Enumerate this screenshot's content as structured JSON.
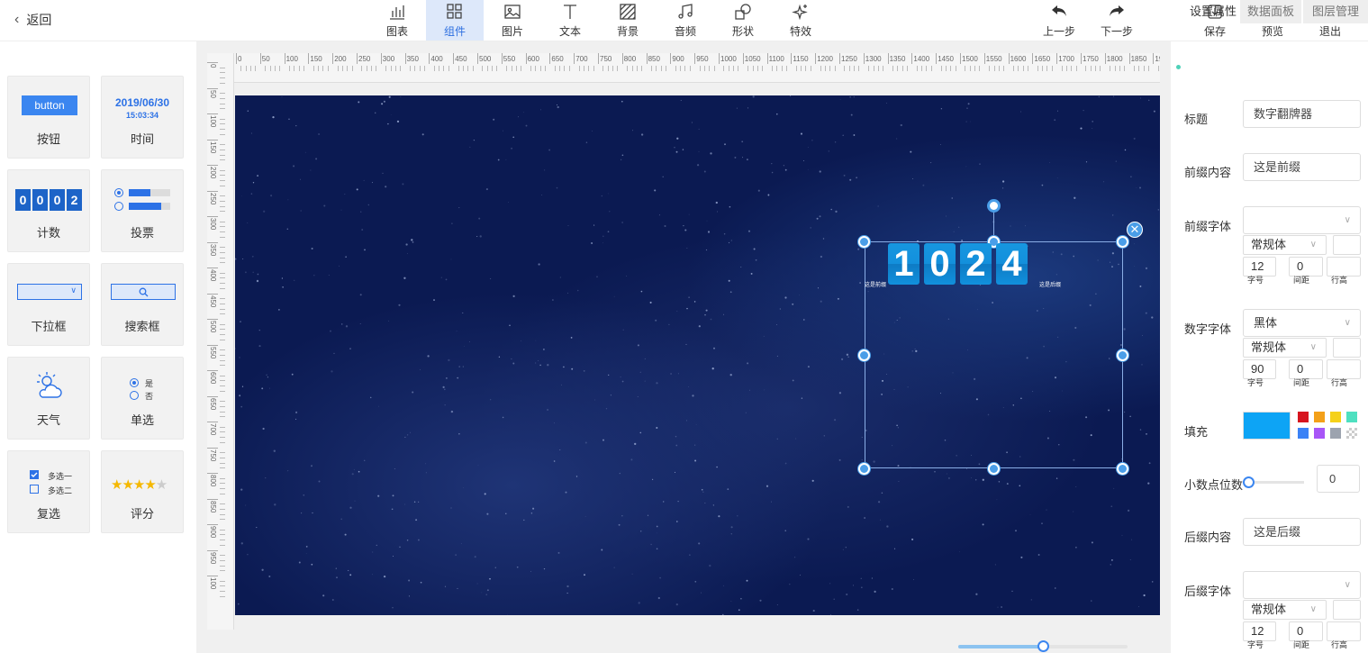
{
  "topbar": {
    "back_label": "返回",
    "tools": [
      {
        "label": "图表",
        "icon": "chart-icon"
      },
      {
        "label": "组件",
        "icon": "grid-icon",
        "active": true
      },
      {
        "label": "图片",
        "icon": "image-icon"
      },
      {
        "label": "文本",
        "icon": "text-icon"
      },
      {
        "label": "背景",
        "icon": "background-icon"
      },
      {
        "label": "音频",
        "icon": "music-icon"
      },
      {
        "label": "形状",
        "icon": "shape-icon"
      },
      {
        "label": "特效",
        "icon": "sparkle-icon"
      }
    ],
    "undo_label": "上一步",
    "redo_label": "下一步",
    "save_label": "保存",
    "preview_label": "预览",
    "exit_label": "退出"
  },
  "components": [
    {
      "label": "按钮",
      "preview_text": "button"
    },
    {
      "label": "时间",
      "preview_date": "2019/06/30",
      "preview_time": "15:03:34"
    },
    {
      "label": "计数",
      "preview_digits": [
        "0",
        "0",
        "0",
        "2"
      ]
    },
    {
      "label": "投票"
    },
    {
      "label": "下拉框"
    },
    {
      "label": "搜索框"
    },
    {
      "label": "天气"
    },
    {
      "label": "单选",
      "options": [
        "是",
        "否"
      ]
    },
    {
      "label": "复选",
      "options": [
        "多选一",
        "多选二"
      ]
    },
    {
      "label": "评分",
      "stars": 3.5
    }
  ],
  "ruler": {
    "h_ticks": [
      "0",
      "50",
      "100",
      "150",
      "200",
      "250",
      "300",
      "350",
      "400",
      "450",
      "500",
      "550",
      "600",
      "650",
      "700",
      "750",
      "800",
      "850",
      "900",
      "950",
      "1000",
      "1050",
      "1100",
      "1150",
      "1200",
      "1250",
      "1300",
      "1350",
      "1400",
      "1450",
      "1500",
      "1550",
      "1600",
      "1650",
      "1700",
      "1750",
      "1800",
      "1850",
      "19"
    ],
    "v_ticks": [
      "0",
      "50",
      "100",
      "150",
      "200",
      "250",
      "300",
      "350",
      "400",
      "450",
      "500",
      "550",
      "600",
      "650",
      "700",
      "750",
      "800",
      "850",
      "900",
      "950",
      "100"
    ]
  },
  "canvas": {
    "flip_digits": [
      "1",
      "0",
      "2",
      "4"
    ],
    "prefix_text": "这是前缀",
    "suffix_text": "这是后缀"
  },
  "panel": {
    "tabs": [
      "设置属性",
      "数据面板",
      "图层管理"
    ],
    "title_label": "标题",
    "title_value": "数字翻牌器",
    "prefix_label": "前缀内容",
    "prefix_value": "这是前缀",
    "prefix_font_label": "前缀字体",
    "prefix_font_value": "",
    "prefix_style": "常规体",
    "prefix_size": "12",
    "prefix_spacing": "0",
    "number_font_label": "数字字体",
    "number_font_value": "黑体",
    "number_style": "常规体",
    "number_size": "90",
    "number_spacing": "0",
    "size_caption": "字号",
    "spacing_caption": "间距",
    "lineheight_caption": "行高",
    "fill_label": "填充",
    "fill_color": "#0da4f5",
    "palette": [
      "#d7141e",
      "#f3a019",
      "#f5d119",
      "#4ee0c0",
      "#3b82f6",
      "#a855f7",
      "#9ca3af",
      "#e5e5e5"
    ],
    "decimals_label": "小数点位数",
    "decimals_value": "0",
    "suffix_label": "后缀内容",
    "suffix_value": "这是后缀",
    "suffix_font_label": "后缀字体",
    "suffix_font_value": "",
    "suffix_style": "常规体",
    "suffix_size": "12",
    "suffix_spacing": "0"
  },
  "zoom": 0.5
}
